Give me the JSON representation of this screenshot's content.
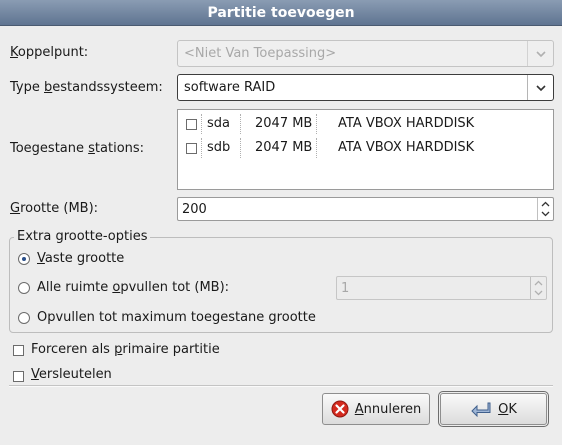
{
  "dialog": {
    "title": "Partitie toevoegen"
  },
  "mount_point": {
    "label_pre": "",
    "label_mnemonic": "K",
    "label_post": "oppelpunt:",
    "value": "<Niet Van Toepassing>"
  },
  "fs_type": {
    "label_pre": "Type ",
    "label_mnemonic": "b",
    "label_post": "estandssysteem:",
    "value": "software RAID"
  },
  "drives": {
    "label_pre": "Toegestane ",
    "label_mnemonic": "s",
    "label_post": "tations:",
    "rows": [
      {
        "name": "sda",
        "size": "2047 MB",
        "model": "ATA VBOX HARDDISK",
        "checked": false
      },
      {
        "name": "sdb",
        "size": "2047 MB",
        "model": "ATA VBOX HARDDISK",
        "checked": false
      }
    ]
  },
  "size": {
    "label_pre": "",
    "label_mnemonic": "G",
    "label_post": "rootte (MB):",
    "value": "200"
  },
  "extra": {
    "title": "Extra grootte-opties",
    "fixed": {
      "pre": "",
      "mn": "V",
      "post": "aste grootte",
      "selected": true
    },
    "fill_upto": {
      "pre": "Alle ruimte ",
      "mn": "o",
      "post": "pvullen tot (MB):",
      "selected": false,
      "value": "1"
    },
    "fill_max": {
      "pre": "Opvullen tot maximum toegestane grootte",
      "mn": "",
      "post": "",
      "selected": false
    }
  },
  "force_primary": {
    "pre": "Forceren als ",
    "mn": "p",
    "post": "rimaire partitie",
    "checked": false
  },
  "encrypt": {
    "pre": "",
    "mn": "V",
    "post": "ersleutelen",
    "checked": false
  },
  "buttons": {
    "cancel": {
      "pre": "",
      "mn": "A",
      "post": "nnuleren"
    },
    "ok": {
      "pre": "",
      "mn": "O",
      "post": "K"
    }
  }
}
